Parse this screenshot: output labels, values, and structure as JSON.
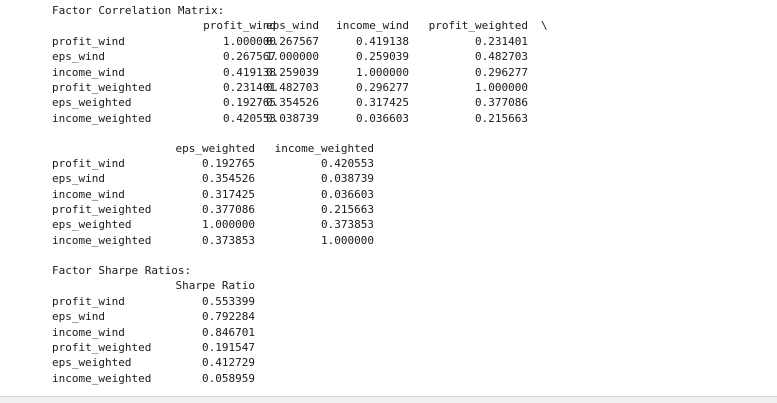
{
  "console": {
    "corr_title": "Factor Correlation Matrix:",
    "continuation_marker": "\\",
    "corr_block1_columns": [
      "profit_wind",
      "eps_wind",
      "income_wind",
      "profit_weighted"
    ],
    "corr_block2_columns": [
      "eps_weighted",
      "income_weighted"
    ],
    "row_labels": [
      "profit_wind",
      "eps_wind",
      "income_wind",
      "profit_weighted",
      "eps_weighted",
      "income_weighted"
    ],
    "corr_block1_values": [
      [
        "1.000000",
        "0.267567",
        "0.419138",
        "0.231401"
      ],
      [
        "0.267567",
        "1.000000",
        "0.259039",
        "0.482703"
      ],
      [
        "0.419138",
        "0.259039",
        "1.000000",
        "0.296277"
      ],
      [
        "0.231401",
        "0.482703",
        "0.296277",
        "1.000000"
      ],
      [
        "0.192765",
        "0.354526",
        "0.317425",
        "0.377086"
      ],
      [
        "0.420553",
        "0.038739",
        "0.036603",
        "0.215663"
      ]
    ],
    "corr_block2_values": [
      [
        "0.192765",
        "0.420553"
      ],
      [
        "0.354526",
        "0.038739"
      ],
      [
        "0.317425",
        "0.036603"
      ],
      [
        "0.377086",
        "0.215663"
      ],
      [
        "1.000000",
        "0.373853"
      ],
      [
        "0.373853",
        "1.000000"
      ]
    ],
    "sharpe_title": "Factor Sharpe Ratios:",
    "sharpe_column": "Sharpe Ratio",
    "sharpe_values": [
      "0.553399",
      "0.792284",
      "0.846701",
      "0.191547",
      "0.412729",
      "0.058959"
    ]
  }
}
